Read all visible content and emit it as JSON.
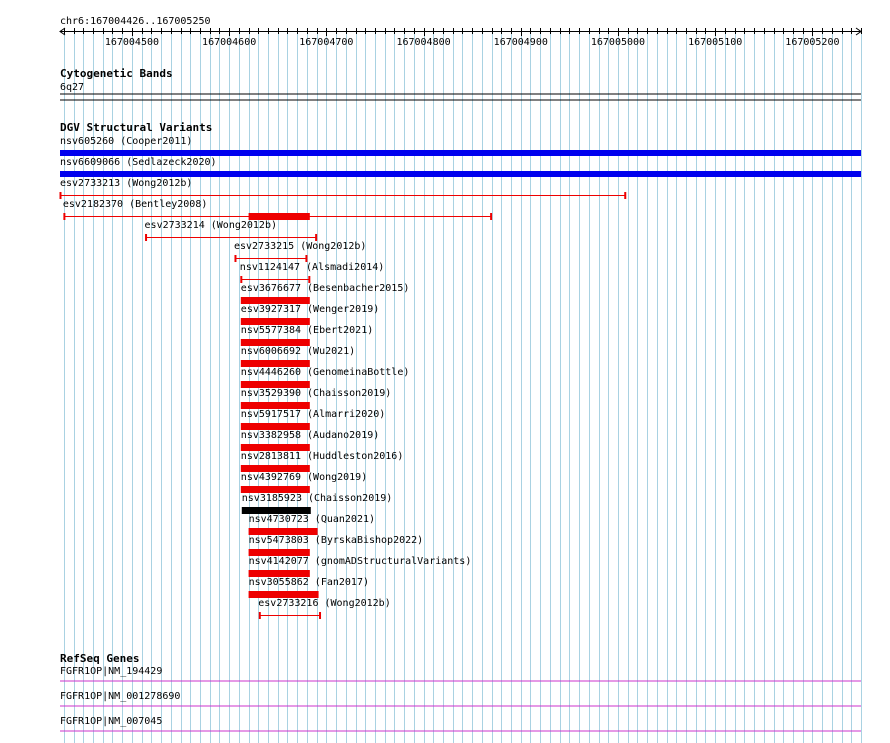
{
  "coordinate_label": "chr6:167004426..167005250",
  "ruler": {
    "start": 167004426,
    "end": 167005250,
    "ticks": [
      167004500,
      167004600,
      167004700,
      167004800,
      167004900,
      167005000,
      167005100,
      167005200
    ]
  },
  "tracks": {
    "cytogenetic_bands": {
      "title": "Cytogenetic Bands",
      "band": "6q27"
    },
    "dgv": {
      "title": "DGV Structural Variants",
      "variants": [
        {
          "label": "nsv605260 (Cooper2011)",
          "start": 167004426,
          "end": 167005250,
          "thick_start": 167004426,
          "thick_end": 167005250,
          "color": "#0000ee",
          "style": "full"
        },
        {
          "label": "nsv6609066 (Sedlazeck2020)",
          "start": 167004426,
          "end": 167005250,
          "thick_start": 167004426,
          "thick_end": 167005250,
          "color": "#0000ee",
          "style": "full"
        },
        {
          "label": "esv2733213 (Wong2012b)",
          "start": 167004426,
          "end": 167005008,
          "color": "#ee0000",
          "style": "whisker"
        },
        {
          "label": "esv2182370 (Bentley2008)",
          "start": 167004430,
          "end": 167004870,
          "thick_start": 167004620,
          "thick_end": 167004683,
          "color": "#ee0000",
          "style": "whisker"
        },
        {
          "label": "esv2733214 (Wong2012b)",
          "start": 167004514,
          "end": 167004690,
          "color": "#ee0000",
          "style": "whisker"
        },
        {
          "label": "esv2733215 (Wong2012b)",
          "start": 167004606,
          "end": 167004680,
          "color": "#ee0000",
          "style": "whisker"
        },
        {
          "label": "nsv1124147 (Alsmadi2014)",
          "start": 167004612,
          "end": 167004683,
          "color": "#ee0000",
          "style": "whisker"
        },
        {
          "label": "esv3676677 (Besenbacher2015)",
          "start": 167004612,
          "end": 167004683,
          "color": "#ee0000",
          "style": "block"
        },
        {
          "label": "esv3927317 (Wenger2019)",
          "start": 167004612,
          "end": 167004683,
          "color": "#ee0000",
          "style": "block"
        },
        {
          "label": "nsv5577384 (Ebert2021)",
          "start": 167004612,
          "end": 167004683,
          "color": "#ee0000",
          "style": "block"
        },
        {
          "label": "nsv6006692 (Wu2021)",
          "start": 167004612,
          "end": 167004683,
          "color": "#ee0000",
          "style": "block"
        },
        {
          "label": "nsv4446260 (GenomeinaBottle)",
          "start": 167004612,
          "end": 167004683,
          "color": "#ee0000",
          "style": "block"
        },
        {
          "label": "nsv3529390 (Chaisson2019)",
          "start": 167004612,
          "end": 167004683,
          "color": "#ee0000",
          "style": "block"
        },
        {
          "label": "nsv5917517 (Almarri2020)",
          "start": 167004612,
          "end": 167004683,
          "color": "#ee0000",
          "style": "block"
        },
        {
          "label": "nsv3382958 (Audano2019)",
          "start": 167004612,
          "end": 167004683,
          "color": "#ee0000",
          "style": "block"
        },
        {
          "label": "nsv2813811 (Huddleston2016)",
          "start": 167004612,
          "end": 167004683,
          "color": "#ee0000",
          "style": "block"
        },
        {
          "label": "nsv4392769 (Wong2019)",
          "start": 167004612,
          "end": 167004683,
          "color": "#ee0000",
          "style": "block"
        },
        {
          "label": "nsv3185923 (Chaisson2019)",
          "start": 167004613,
          "end": 167004684,
          "color": "#000000",
          "style": "block"
        },
        {
          "label": "nsv4730723 (Quan2021)",
          "start": 167004620,
          "end": 167004691,
          "color": "#ee0000",
          "style": "block"
        },
        {
          "label": "nsv5473803 (ByrskaBishop2022)",
          "start": 167004620,
          "end": 167004683,
          "color": "#ee0000",
          "style": "block"
        },
        {
          "label": "nsv4142077 (gnomADStructuralVariants)",
          "start": 167004620,
          "end": 167004683,
          "color": "#ee0000",
          "style": "block"
        },
        {
          "label": "nsv3055862 (Fan2017)",
          "start": 167004620,
          "end": 167004692,
          "color": "#ee0000",
          "style": "block"
        },
        {
          "label": "esv2733216 (Wong2012b)",
          "start": 167004631,
          "end": 167004694,
          "color": "#ee0000",
          "style": "whisker"
        }
      ]
    },
    "refseq": {
      "title": "RefSeq Genes",
      "color": "#cc33cc",
      "genes": [
        {
          "label": "FGFR1OP|NM_194429"
        },
        {
          "label": "FGFR1OP|NM_001278690"
        },
        {
          "label": "FGFR1OP|NM_007045"
        }
      ]
    }
  }
}
